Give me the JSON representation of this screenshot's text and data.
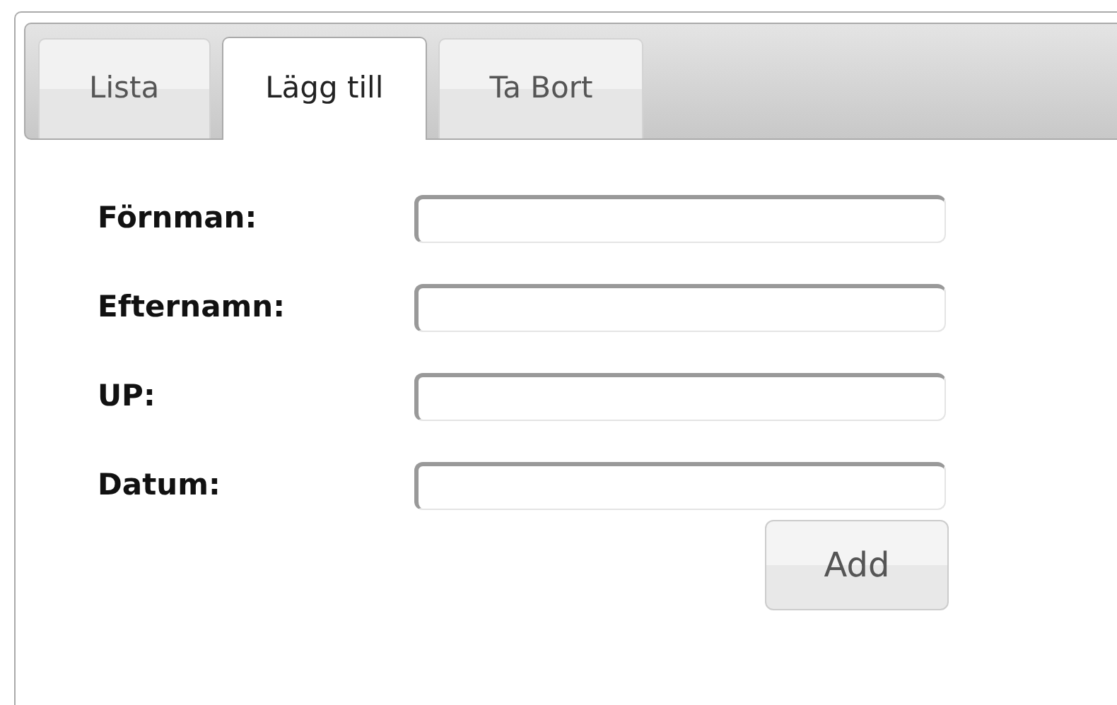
{
  "tabs": [
    {
      "label": "Lista",
      "selected": false
    },
    {
      "label": "Lägg till",
      "selected": true
    },
    {
      "label": "Ta Bort",
      "selected": false
    }
  ],
  "form": {
    "fields": [
      {
        "label": "Förnman:"
      },
      {
        "label": "Efternamn:"
      },
      {
        "label": "UP:"
      },
      {
        "label": "Datum:"
      }
    ],
    "button": "Add"
  }
}
